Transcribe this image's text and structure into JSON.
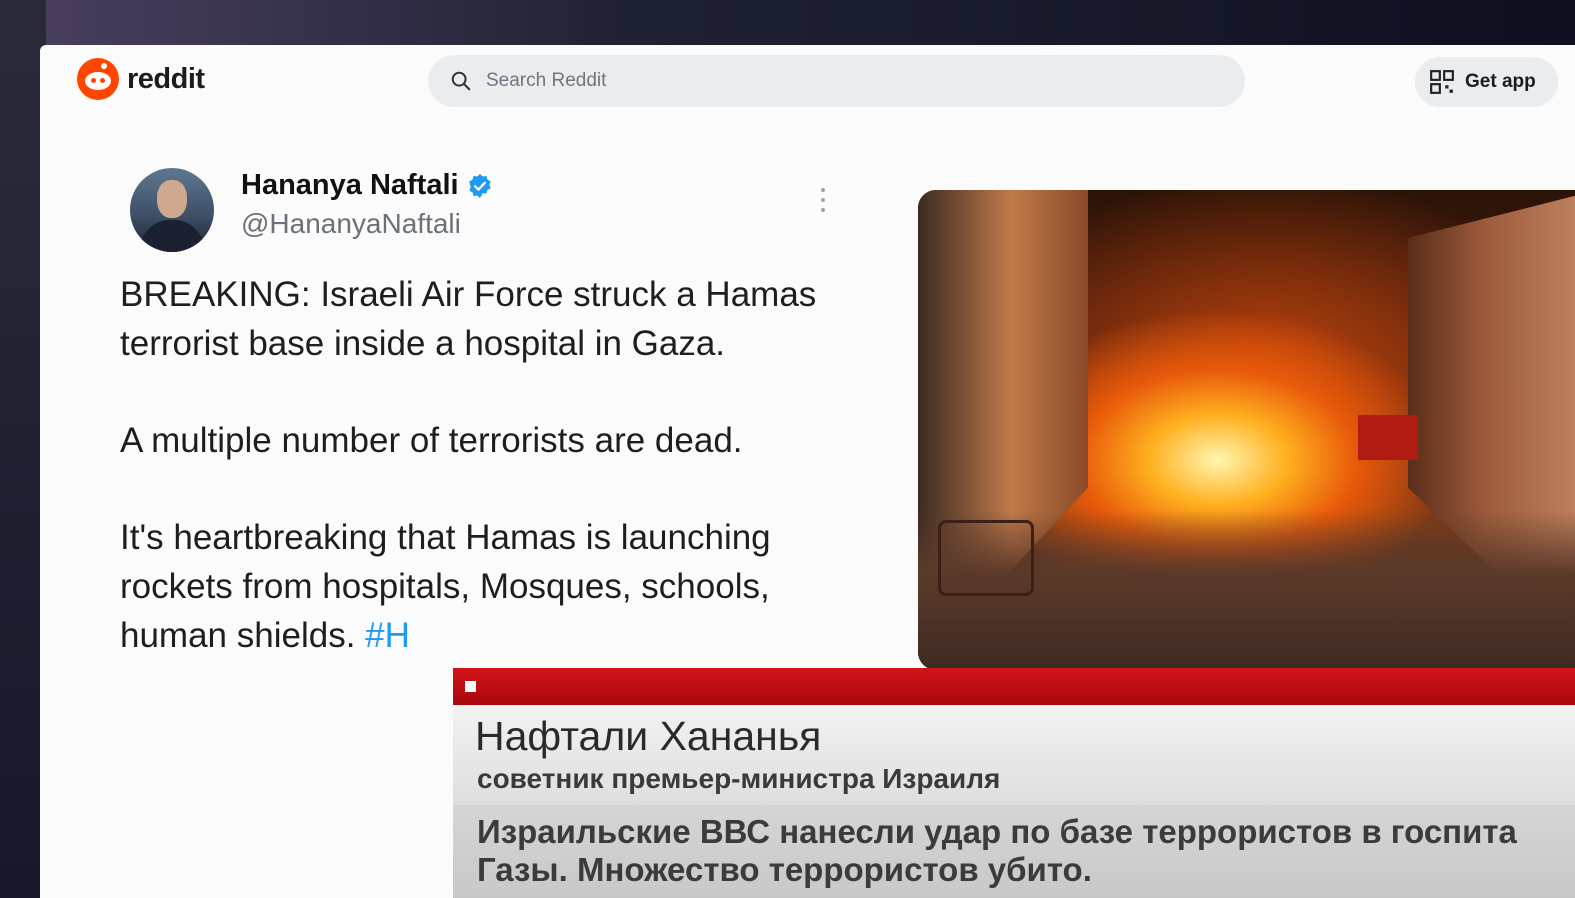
{
  "reddit": {
    "logo_text": "reddit",
    "search_placeholder": "Search Reddit",
    "get_app_label": "Get app"
  },
  "tweet": {
    "author_name": "Hananya Naftali",
    "handle": "@HananyaNaftali",
    "verified": true,
    "paragraphs": [
      "BREAKING: Israeli Air Force struck a Hamas terrorist base inside a hospital in Gaza.",
      "A multiple number of terrorists are dead.",
      "It's heartbreaking that Hamas is launching rockets from hospitals, Mosques, schools,"
    ],
    "last_line_visible": "human shields.",
    "hashtag_visible": "#H"
  },
  "broadcast": {
    "name": "Нафтали Хананья",
    "title": "советник премьер-министра Израиля",
    "quote_line_1": "Израильские ВВС нанесли удар по базе террористов в госпита",
    "quote_line_2": "Газы. Множество террористов убито."
  },
  "colors": {
    "reddit_orange": "#ff4500",
    "verified_blue": "#1d9bf0",
    "broadcast_red": "#c40f14"
  }
}
